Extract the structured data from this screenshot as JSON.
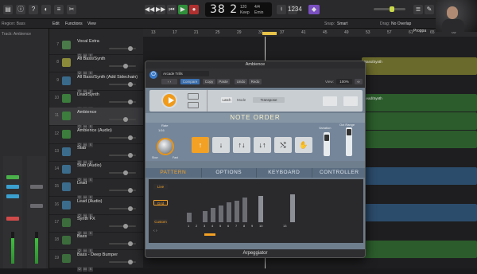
{
  "transport": {
    "lcd_position": "38 2",
    "lcd_tempo": "120",
    "lcd_tempo_label": "Keep",
    "lcd_sig": "4/4",
    "lcd_key": "Emin"
  },
  "toolbar2": {
    "region_label": "Region: Bass",
    "edit": "Edit",
    "functions": "Functions",
    "view": "View",
    "snap_label": "Snap:",
    "snap_value": "Smart",
    "drag_label": "Drag:",
    "drag_value": "No Overlap"
  },
  "inspector": {
    "track_name": "Track: Ambience"
  },
  "tracks": [
    {
      "num": "7",
      "name": "Vocal Extra",
      "color": "#4a7a4a"
    },
    {
      "num": "8",
      "name": "All Bass/Synth",
      "color": "#8a8a3a"
    },
    {
      "num": "9",
      "name": "All Bass/Synth (Add Sidechain)",
      "color": "#3a6a8a"
    },
    {
      "num": "10",
      "name": "Lead/Synth",
      "color": "#3c7c3c"
    },
    {
      "num": "11",
      "name": "Ambience",
      "color": "#3c7c3c",
      "selected": true
    },
    {
      "num": "12",
      "name": "Ambience (Audio)",
      "color": "#3c7c3c"
    },
    {
      "num": "13",
      "name": "Stab",
      "color": "#3c6c8c"
    },
    {
      "num": "14",
      "name": "Stab (Audio)",
      "color": "#3c6c8c"
    },
    {
      "num": "15",
      "name": "Lead",
      "color": "#3c6c8c"
    },
    {
      "num": "16",
      "name": "Lead (Audio)",
      "color": "#3c6c8c"
    },
    {
      "num": "17",
      "name": "Synth FX",
      "color": "#3c6c3c"
    },
    {
      "num": "18",
      "name": "Bass",
      "color": "#3c6c3c"
    },
    {
      "num": "19",
      "name": "Bass - Deep Bumper",
      "color": "#3c6c3c"
    }
  ],
  "ruler": [
    "13",
    "17",
    "21",
    "25",
    "29",
    "33",
    "37",
    "41",
    "45",
    "49",
    "53",
    "57",
    "61",
    "65",
    "69"
  ],
  "ruler_marker": "Proppa",
  "arrange_labels": {
    "region_bass_synth": "Bass/Synth",
    "region_lead_synth": "Lead/Synth"
  },
  "plugin": {
    "title": "Ambience",
    "preset": "Arcade Trills",
    "compare": "Compare",
    "copy": "Copy",
    "paste": "Paste",
    "undo": "Undo",
    "redo": "Redo",
    "view_label": "View:",
    "view_value": "100%",
    "latch": "Latch",
    "mode_label": "Mode",
    "mode_value": "Transpose",
    "note_order": "NOTE ORDER",
    "rate_label": "Rate",
    "rate_value": "1/16",
    "slow": "Slow",
    "fast": "Fast",
    "variation_label": "Variation",
    "oct_range_label": "Oct Range",
    "order_buttons": [
      "↑",
      "↓",
      "↑↓",
      "↓↑",
      "⤭",
      "✋"
    ],
    "order_selected": 0,
    "tabs": [
      "PATTERN",
      "OPTIONS",
      "KEYBOARD",
      "CONTROLLER"
    ],
    "active_tab": 0,
    "live": "Live",
    "grid": "Grid",
    "custom": "Custom",
    "pattern_steps": [
      0.28,
      0,
      0.32,
      0.4,
      0.48,
      0.56,
      0.62,
      0.7,
      0,
      0.75,
      0,
      0,
      0,
      0.8,
      0,
      0
    ],
    "step_numbers": [
      "1",
      "2",
      "3",
      "4",
      "5",
      "6",
      "7",
      "8",
      "9",
      "10",
      "",
      "",
      "13",
      "",
      "",
      ""
    ],
    "footer": "Arpeggiator"
  }
}
